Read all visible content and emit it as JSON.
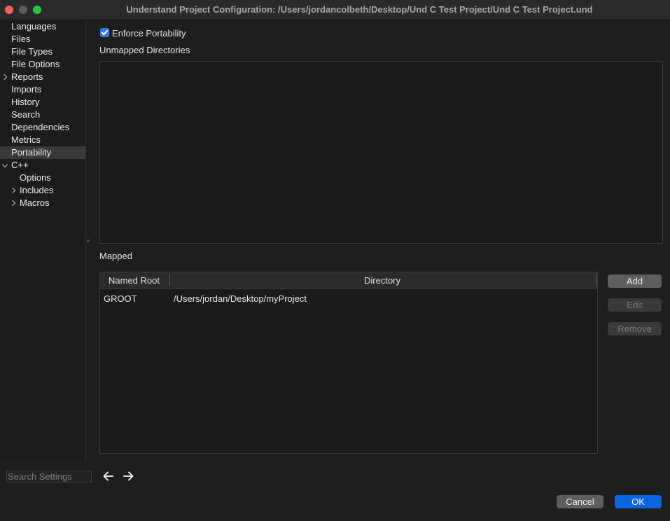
{
  "window": {
    "title": "Understand Project Configuration: /Users/jordancolbeth/Desktop/Und C Test Project/Und C Test Project.und"
  },
  "sidebar": {
    "items": [
      {
        "label": "Languages"
      },
      {
        "label": "Files"
      },
      {
        "label": "File Types"
      },
      {
        "label": "File Options"
      },
      {
        "label": "Reports",
        "expander": "collapsed"
      },
      {
        "label": "Imports"
      },
      {
        "label": "History"
      },
      {
        "label": "Search"
      },
      {
        "label": "Dependencies"
      },
      {
        "label": "Metrics"
      },
      {
        "label": "Portability",
        "selected": true
      },
      {
        "label": "C++",
        "expander": "expanded"
      },
      {
        "label": "Options"
      },
      {
        "label": "Includes",
        "expander": "collapsed"
      },
      {
        "label": "Macros",
        "expander": "collapsed"
      }
    ],
    "search_placeholder": "Search Settings"
  },
  "portability": {
    "enforce_label": "Enforce Portability",
    "enforce_checked": true,
    "unmapped_title": "Unmapped Directories",
    "mapped_title": "Mapped",
    "table": {
      "columns": [
        "Named Root",
        "Directory"
      ],
      "rows": [
        [
          "GROOT",
          "/Users/jordan/Desktop/myProject"
        ]
      ]
    },
    "buttons": {
      "add": "Add",
      "edit": "Edit",
      "remove": "Remove"
    }
  },
  "footer": {
    "cancel": "Cancel",
    "ok": "OK"
  },
  "colors": {
    "accent": "#0a63e0",
    "checkbox": "#2f7de5",
    "close": "#ff5f57",
    "maximize": "#28c840"
  },
  "icons": {
    "back": "arrow-left-icon",
    "forward": "arrow-right-icon"
  }
}
